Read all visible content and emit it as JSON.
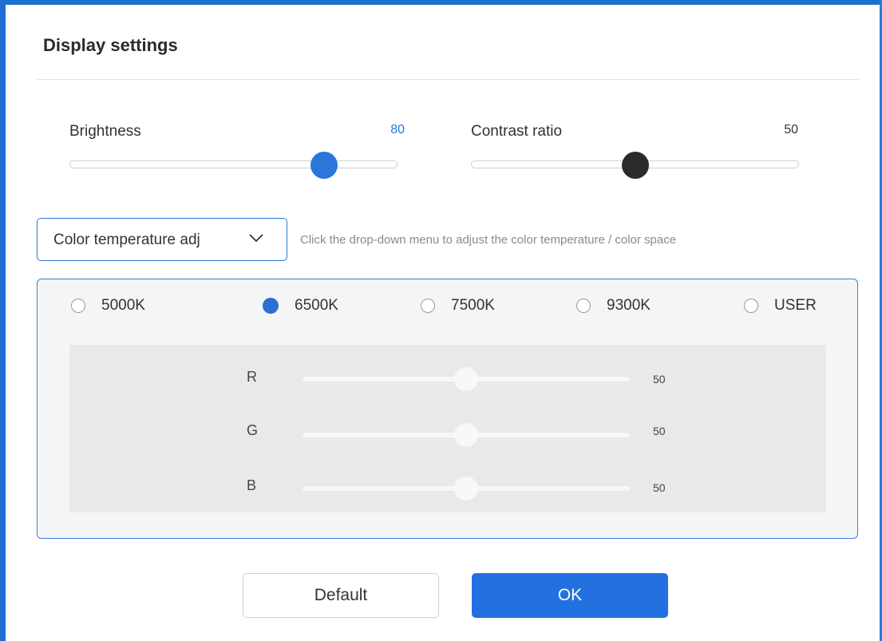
{
  "dialog": {
    "title": "Display settings"
  },
  "brightness": {
    "label": "Brightness",
    "value": "80",
    "level": 0.8,
    "accent": "#2a76db"
  },
  "contrast": {
    "label": "Contrast ratio",
    "value": "50",
    "level": 0.5,
    "accent": "#2b2b2b"
  },
  "color_temp": {
    "dropdown_value": "Color temperature adj",
    "hint": "Click the drop-down menu to adjust the color temperature / color space",
    "options": [
      "5000K",
      "6500K",
      "7500K",
      "9300K",
      "USER"
    ],
    "selected": "6500K"
  },
  "rgb": [
    {
      "label": "R",
      "value": "50"
    },
    {
      "label": "G",
      "value": "50"
    },
    {
      "label": "B",
      "value": "50"
    }
  ],
  "buttons": {
    "default_label": "Default",
    "ok_label": "OK"
  },
  "colors": {
    "accent": "#2371e0",
    "frame": "#1e6fcf"
  }
}
